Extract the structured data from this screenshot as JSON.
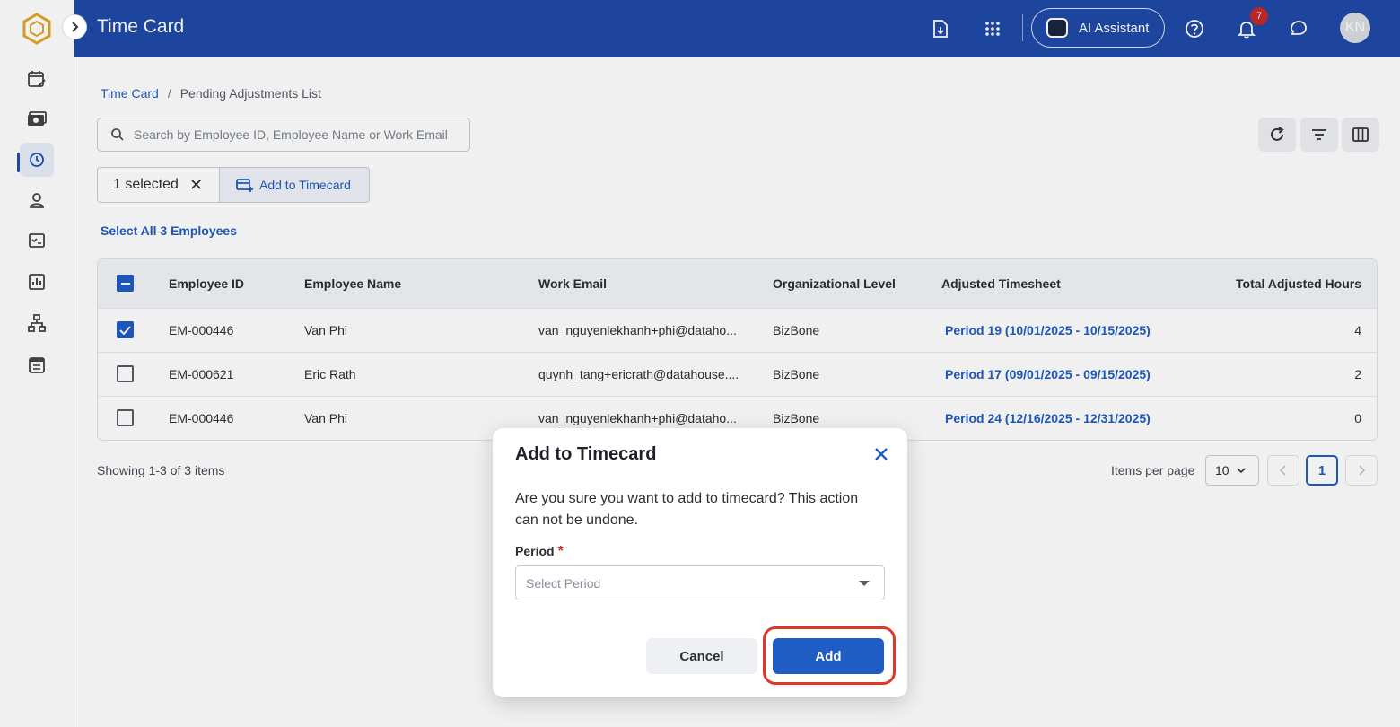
{
  "header": {
    "title": "Time Card",
    "ai_assistant_label": "AI Assistant",
    "notification_count": "7",
    "avatar_initials": "KN"
  },
  "breadcrumb": {
    "root": "Time Card",
    "separator": "/",
    "current": "Pending Adjustments List"
  },
  "search": {
    "placeholder": "Search by Employee ID, Employee Name or Work Email"
  },
  "selection": {
    "count_label": "1 selected",
    "add_button_label": "Add to Timecard",
    "select_all_label": "Select All 3 Employees"
  },
  "table": {
    "headers": {
      "employee_id": "Employee ID",
      "employee_name": "Employee Name",
      "work_email": "Work Email",
      "org_level": "Organizational Level",
      "adjusted_timesheet": "Adjusted Timesheet",
      "total_hours": "Total Adjusted Hours"
    },
    "rows": [
      {
        "checked": true,
        "id": "EM-000446",
        "name": "Van Phi",
        "email": "van_nguyenlekhanh+phi@dataho...",
        "org": "BizBone",
        "timesheet": "Period 19 (10/01/2025 - 10/15/2025)",
        "hours": "4"
      },
      {
        "checked": false,
        "id": "EM-000621",
        "name": "Eric Rath",
        "email": "quynh_tang+ericrath@datahouse....",
        "org": "BizBone",
        "timesheet": "Period 17 (09/01/2025 - 09/15/2025)",
        "hours": "2"
      },
      {
        "checked": false,
        "id": "EM-000446",
        "name": "Van Phi",
        "email": "van_nguyenlekhanh+phi@dataho...",
        "org": "BizBone",
        "timesheet": "Period 24 (12/16/2025 - 12/31/2025)",
        "hours": "0"
      }
    ]
  },
  "pagination": {
    "showing": "Showing 1-3 of 3 items",
    "items_per_page_label": "Items per page",
    "items_per_page_value": "10",
    "current_page": "1"
  },
  "modal": {
    "title": "Add to Timecard",
    "message": "Are you sure you want to add to timecard? This action can not be undone.",
    "period_label": "Period",
    "required_mark": "*",
    "period_placeholder": "Select Period",
    "cancel_label": "Cancel",
    "add_label": "Add"
  },
  "colors": {
    "header_bg": "#1f4aa8",
    "accent": "#1f5cc4",
    "highlight": "#e2362a"
  }
}
